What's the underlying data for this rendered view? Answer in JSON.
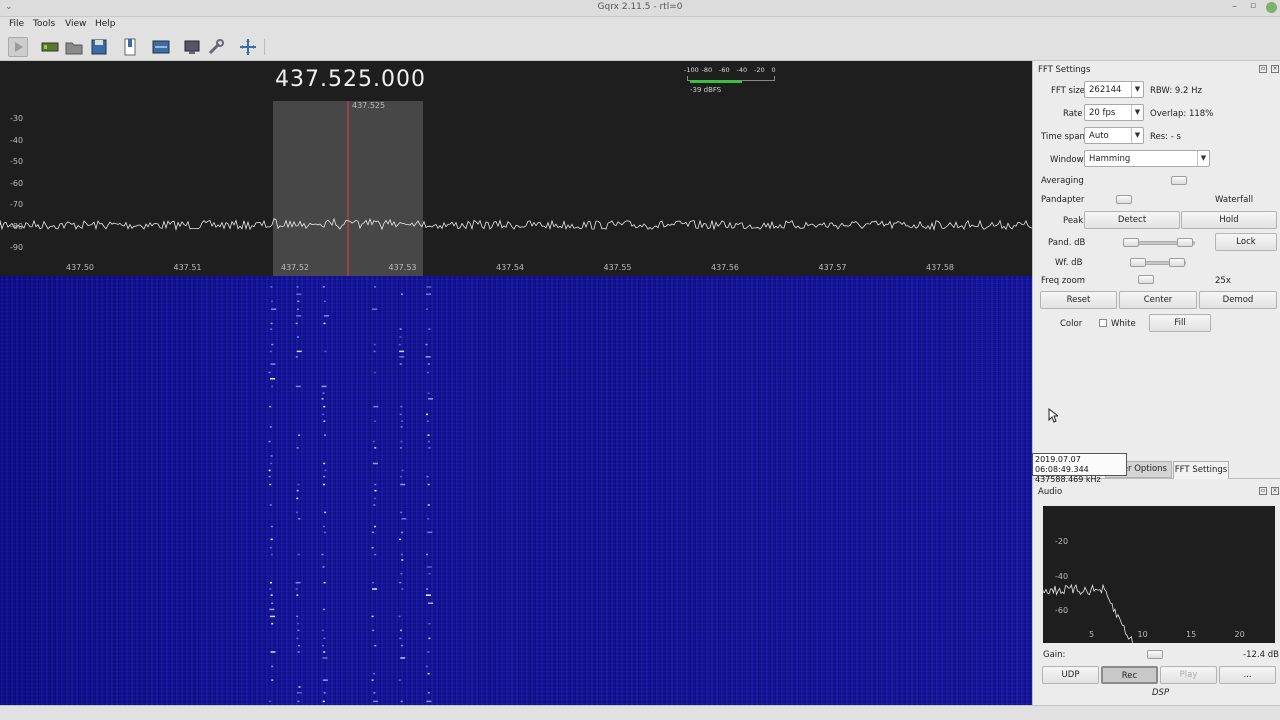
{
  "window": {
    "title": "Gqrx 2.11.5 - rtl=0"
  },
  "menu": [
    "File",
    "Tools",
    "View",
    "Help"
  ],
  "toolbar": {
    "icons": [
      "play-icon",
      "hardware-icon",
      "open-icon",
      "save-icon",
      "bookmark-icon",
      "device-icon",
      "display-icon",
      "settings-icon",
      "fullscreen-icon"
    ]
  },
  "plot": {
    "frequency_display": "437.525.000",
    "filter_label": "437.525",
    "y_ticks": [
      "-30",
      "-40",
      "-50",
      "-60",
      "-70",
      "-80",
      "-90"
    ],
    "x_ticks": [
      "437.50",
      "437.51",
      "437.52",
      "437.53",
      "437.54",
      "437.55",
      "437.56",
      "437.57",
      "437.58"
    ],
    "meter_ticks": [
      "-100",
      "-80",
      "-60",
      "-40",
      "-20",
      "0"
    ],
    "meter_value": "-39 dBFS",
    "meter_level": 0.61
  },
  "tooltip": {
    "line1": "2019.07.07 06:08:49.344",
    "line2": "437588.469 kHz"
  },
  "fft": {
    "title": "FFT Settings",
    "fft_size_label": "FFT size",
    "fft_size": "262144",
    "rbw": "RBW: 9.2 Hz",
    "rate_label": "Rate",
    "rate": "20 fps",
    "overlap": "Overlap: 118%",
    "timespan_label": "Time span",
    "timespan": "Auto",
    "res": "Res: - s",
    "window_label": "Window",
    "window": "Hamming",
    "averaging_label": "Averaging",
    "pandapter_label": "Pandapter",
    "waterfall_label": "Waterfall",
    "peak_label": "Peak",
    "detect_label": "Detect",
    "hold_label": "Hold",
    "pand_db_label": "Pand. dB",
    "lock_label": "Lock",
    "wf_db_label": "Wf. dB",
    "freq_zoom_label": "Freq zoom",
    "freq_zoom_value": "25x",
    "reset_label": "Reset",
    "center_label": "Center",
    "demod_label": "Demod",
    "color_label": "Color",
    "white_label": "White",
    "fill_label": "Fill"
  },
  "tabs": {
    "options_partial": "er Options",
    "fft_settings": "FFT Settings"
  },
  "audio": {
    "title": "Audio",
    "y_ticks": [
      "-20",
      "-40",
      "-60"
    ],
    "x_ticks": [
      "5",
      "10",
      "15",
      "20"
    ],
    "gain_label": "Gain:",
    "gain_value": "-12.4 dB",
    "udp_label": "UDP",
    "rec_label": "Rec",
    "play_label": "Play",
    "more_label": "...",
    "dsp_label": "DSP"
  }
}
